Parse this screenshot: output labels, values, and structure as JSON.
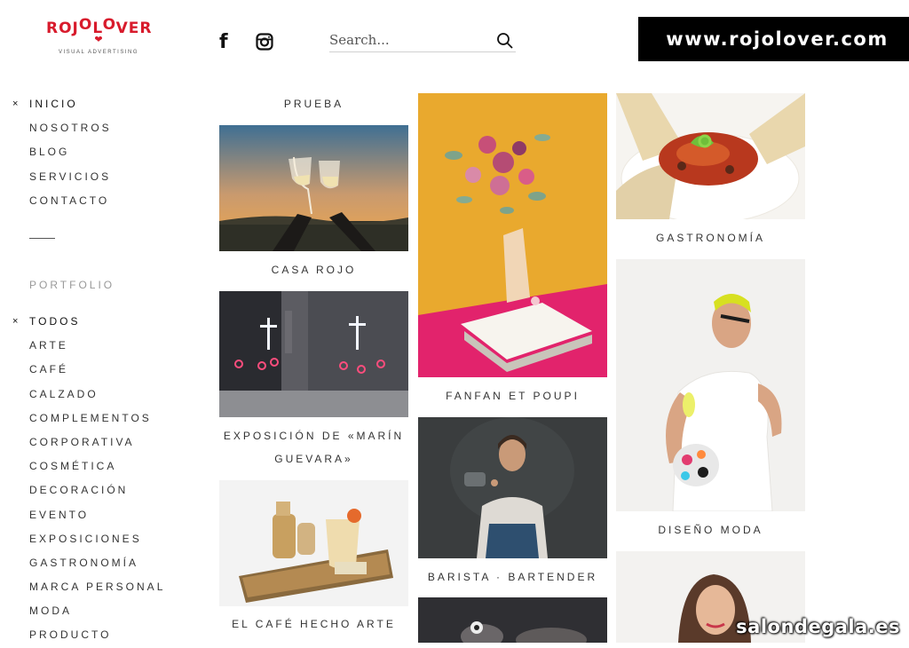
{
  "logo": {
    "prefix": "ROJ",
    "o1": "O",
    "middle": "L",
    "o2": "O",
    "suffix": "VER",
    "heart": "❤",
    "tagline": "VISUAL ADVERTISING"
  },
  "social": {
    "facebook_icon": "facebook-icon",
    "instagram_icon": "instagram-icon",
    "facebook_glyph": "f"
  },
  "search": {
    "placeholder": "Search...",
    "icon": "search-icon"
  },
  "banner": {
    "text": "www.rojolover.com"
  },
  "menu": {
    "items": [
      {
        "label": "INICIO",
        "active": true
      },
      {
        "label": "NOSOTROS"
      },
      {
        "label": "BLOG"
      },
      {
        "label": "SERVICIOS"
      },
      {
        "label": "CONTACTO"
      }
    ],
    "marker": "×"
  },
  "portfolio": {
    "heading": "PORTFOLIO",
    "categories": [
      {
        "label": "TODOS",
        "active": true
      },
      {
        "label": "ARTE"
      },
      {
        "label": "CAFÉ"
      },
      {
        "label": "CALZADO"
      },
      {
        "label": "COMPLEMENTOS"
      },
      {
        "label": "CORPORATIVA"
      },
      {
        "label": "COSMÉTICA"
      },
      {
        "label": "DECORACIÓN"
      },
      {
        "label": "EVENTO"
      },
      {
        "label": "EXPOSICIONES"
      },
      {
        "label": "GASTRONOMÍA"
      },
      {
        "label": "MARCA PERSONAL"
      },
      {
        "label": "MODA"
      },
      {
        "label": "PRODUCTO"
      }
    ]
  },
  "grid": {
    "col1": {
      "prueba": "PRUEBA",
      "casa_rojo": "CASA ROJO",
      "exposicion_1": "EXPOSICIÓN DE «MARÍN",
      "exposicion_2": "GUEVARA»",
      "cafe_arte": "EL CAFÉ HECHO ARTE"
    },
    "col2": {
      "fanfan": "FANFAN ET POUPI",
      "barista": "BARISTA · BARTENDER"
    },
    "col3": {
      "gastronomia": "GASTRONOMÍA",
      "diseno_moda": "DISEÑO MODA"
    }
  },
  "watermark": "salondegala.es"
}
